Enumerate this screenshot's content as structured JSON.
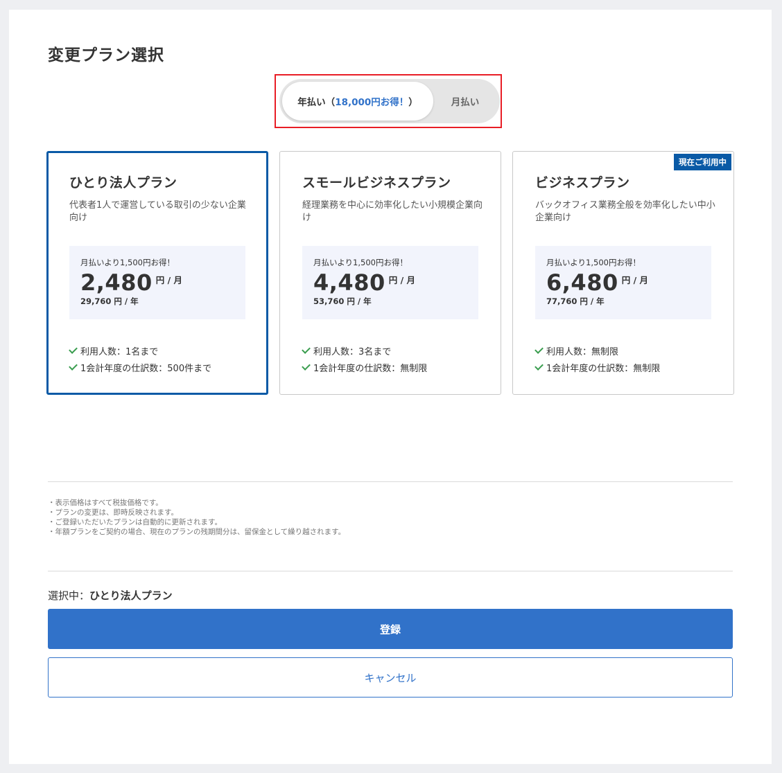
{
  "page_title": "変更プラン選択",
  "billing_toggle": {
    "yearly_label": "年払い（",
    "yearly_savings": "18,000円お得！",
    "yearly_suffix": "）",
    "monthly_label": "月払い",
    "selected": "yearly"
  },
  "plans": [
    {
      "name": "ひとり法人プラン",
      "description": "代表者1人で運営している取引の少ない企業向け",
      "price_note": "月払いより1,500円お得！",
      "price": "2,480",
      "price_unit": "円 / 月",
      "price_yearly": "29,760 円 / 年",
      "features": [
        "利用人数：1名まで",
        "1会計年度の仕訳数：500件まで"
      ],
      "badge": ""
    },
    {
      "name": "スモールビジネスプラン",
      "description": "経理業務を中心に効率化したい小規模企業向け",
      "price_note": "月払いより1,500円お得！",
      "price": "4,480",
      "price_unit": "円 / 月",
      "price_yearly": "53,760 円 / 年",
      "features": [
        "利用人数：3名まで",
        "1会計年度の仕訳数：無制限"
      ],
      "badge": ""
    },
    {
      "name": "ビジネスプラン",
      "description": "バックオフィス業務全般を効率化したい中小企業向け",
      "price_note": "月払いより1,500円お得！",
      "price": "6,480",
      "price_unit": "円 / 月",
      "price_yearly": "77,760 円 / 年",
      "features": [
        "利用人数：無制限",
        "1会計年度の仕訳数：無制限"
      ],
      "badge": "現在ご利用中"
    }
  ],
  "notes": [
    "・表示価格はすべて税抜価格です。",
    "・プランの変更は、即時反映されます。",
    "・ご登録いただいたプランは自動的に更新されます。",
    "・年額プランをご契約の場合、現在のプランの残期間分は、留保金として繰り越されます。"
  ],
  "selection": {
    "label": "選択中：",
    "plan": "ひとり法人プラン"
  },
  "buttons": {
    "register": "登録",
    "cancel": "キャンセル"
  },
  "colors": {
    "primary": "#3172c9",
    "selected_border": "#0a5aa6",
    "highlight_frame": "#e81d25",
    "check": "#3a9d4f"
  }
}
